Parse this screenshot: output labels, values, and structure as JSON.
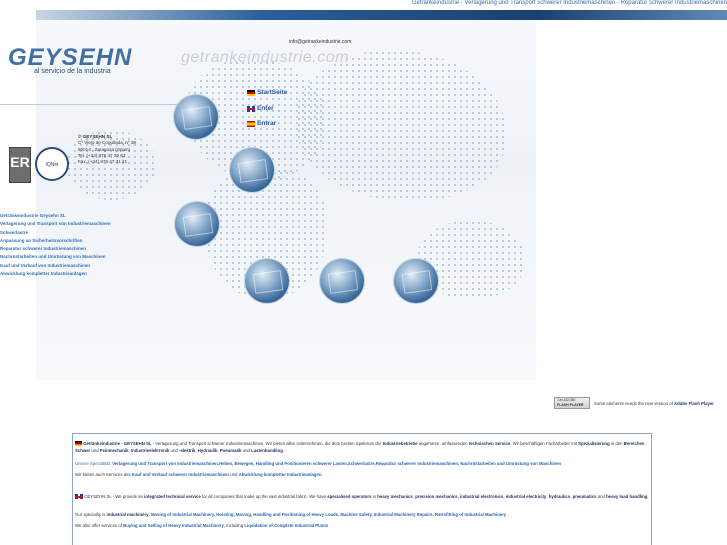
{
  "top_bar": {
    "text": "Getränkeindustrie - Verlagerung und Transport schwerer Industriemaschinen - Reparatur schwerer Industriemaschinen"
  },
  "brand": {
    "logo": "GEYSEHN",
    "tagline": "al servicio de la industria",
    "site_watermark": "getrankeindustrie.com",
    "email": "info@getrankeindustrie.com"
  },
  "languages": [
    {
      "label": "StartSeite",
      "flag": "de"
    },
    {
      "label": "Enter",
      "flag": "uk"
    },
    {
      "label": "Entrar",
      "flag": "es"
    }
  ],
  "certificates": {
    "cert1": "ER",
    "cert2": "IQNet"
  },
  "contact": {
    "company": "© GEYSEHN SL",
    "lines": [
      "Cº Viejo de Cogullada, nº 38",
      "50014 . Zaragoza (Spain)",
      "Tel. (+34) 976 47 29 63",
      "Fax. (+34) 976 47 31 21"
    ]
  },
  "nav": [
    "Getränkeindustrie Geysehn SL",
    "Verlagerung und Transport von Industriemaschinen",
    "Schwerlastre",
    "Anpassung an Sicherheitsvorschriften",
    "Reparatur schwerer Industriemaschinen",
    "Nachrüstarbeiten und Umrüstung von Maschinen",
    "Kauf und Verkauf von Industriemaschinen",
    "Abwicklung kompletter Industrieanlagen"
  ],
  "flash_note": {
    "badge_line1": "Get ADOBE",
    "badge_line2": "FLASH PLAYER",
    "text": "Some elements needs the new version of",
    "product": "Adobe Flash Player"
  },
  "info": {
    "de_p1": {
      "c1": "Getränkeindustrie - GEYSEHN SL",
      "t1": " - Verlagerung und Transport schwerer Industriemaschinen. Wir bieten allen Unternehmen, die dem breiten Spektrum der ",
      "c2": "Industriebetriebe",
      "t2": " angehören, umfassenden ",
      "c3": "technischen Service",
      "t3": ". Wir beschäftigen Facharbeiter mit ",
      "c4": "Spezialisierung",
      "t4": " in den ",
      "c5": "Bereichen Schwer",
      "t5": " und ",
      "c6": "Feinmechanik",
      "t6": ", ",
      "c7": "Industrieelektronik",
      "t7": " und ",
      "c8": "-elektrik",
      "t8": ", ",
      "c9": "Hydraulik",
      "t9": ", ",
      "c10": "Pneumatik",
      "t10": " und ",
      "c11": "Lastenhandling",
      "t11": "."
    },
    "de_p2": {
      "t1": "Unsere Spezialität: ",
      "c1": "Verlagerung und Transport von Industriemaschinen,Heben, Bewegen, Handling und Positionieren schwerer Lasten,Schwerlastre,Reparatur schwerer Industriemaschinen, Nachrüstarbeiten und Umrüstung von Maschinen",
      "t2": " ."
    },
    "de_p3": {
      "t1": "Wir bieten auch Services des ",
      "c1": "Kauf und Verkauf schwerer Industriemaschinen",
      "t2": " und ",
      "c2": "Abwicklung kompletter Industrieanlagen",
      "t3": "."
    },
    "en_p1": {
      "c1": "GEYSEHN SL",
      "t1": " - We provide an ",
      "c2": "integrated technical service",
      "t2": " for all companies that make up the vast industrial fabric. We have ",
      "c3": "specialised operators",
      "t3": " in ",
      "c4": "heavy mechanics",
      "t4": ", ",
      "c5": "precision mechanics",
      "t5": ", ",
      "c6": "industrial electronics",
      "t6": ", ",
      "c7": "industrial electricity",
      "t7": ", ",
      "c8": "hydraulics",
      "t8": ", ",
      "c9": "pneumatics",
      "t9": " and ",
      "c10": "heavy load handling",
      "t10": "."
    },
    "en_p2": {
      "t1": "Our speciality is ",
      "c1": "industrial machinery",
      "t2": ": ",
      "c2": "Moving of Industrial Machinery, Hoisting, Moving, Handling and Positioning of Heavy Loads, Machine Safety, Industrial Machinery Repairs, Retrofitting of Industrial Machinery",
      "t3": " ."
    },
    "en_p3": {
      "t1": "We also offer services of ",
      "c1": "Buying and Selling of Heavy Industrial Machinery",
      "t2": ", including ",
      "c2": "Liquidation of Complete Industrial Plants",
      "t3": "."
    }
  }
}
